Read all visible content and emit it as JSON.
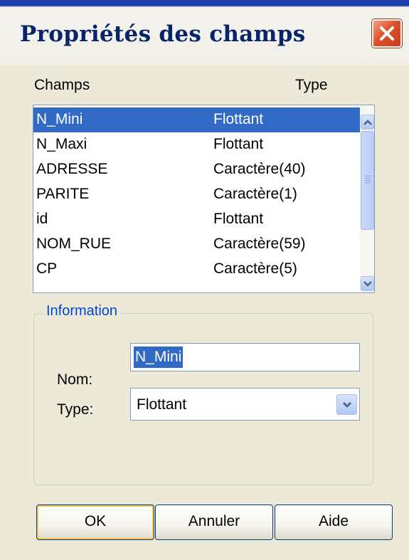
{
  "window": {
    "title": "Propriétés des champs"
  },
  "fields_list": {
    "columns": {
      "name": "Champs",
      "type": "Type"
    },
    "rows": [
      {
        "name": "N_Mini",
        "type": "Flottant",
        "selected": true
      },
      {
        "name": "N_Maxi",
        "type": "Flottant",
        "selected": false
      },
      {
        "name": "ADRESSE",
        "type": "Caractère(40)",
        "selected": false
      },
      {
        "name": "PARITE",
        "type": "Caractère(1)",
        "selected": false
      },
      {
        "name": "id",
        "type": "Flottant",
        "selected": false
      },
      {
        "name": "NOM_RUE",
        "type": "Caractère(59)",
        "selected": false
      },
      {
        "name": "CP",
        "type": "Caractère(5)",
        "selected": false
      }
    ]
  },
  "information": {
    "label": "Information",
    "name_label": "Nom:",
    "name_value": "N_Mini",
    "type_label": "Type:",
    "type_value": "Flottant"
  },
  "buttons": {
    "ok": "OK",
    "cancel": "Annuler",
    "help": "Aide"
  },
  "colors": {
    "selection": "#316ac5",
    "group_label": "#0046d5",
    "title": "#0a246a"
  },
  "icons": {
    "close": "close-icon",
    "scroll_up": "chevron-up-icon",
    "scroll_down": "chevron-down-icon",
    "dropdown": "chevron-down-icon"
  }
}
